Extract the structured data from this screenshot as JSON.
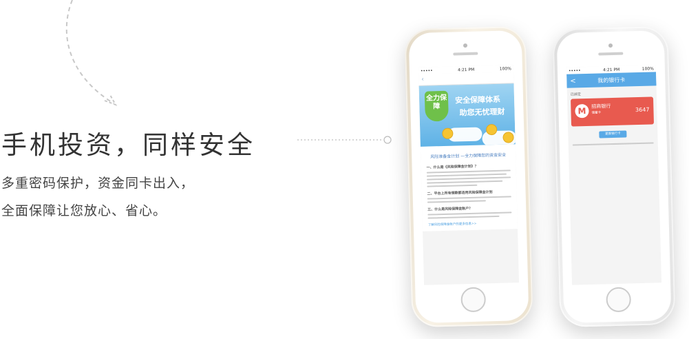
{
  "promo": {
    "heading": "手机投资，同样安全",
    "line1": "多重密码保护，资金同卡出入，",
    "line2": "全面保障让您放心、省心。"
  },
  "phone_left": {
    "status_time": "4:21 PM",
    "status_battery": "100%",
    "banner_badge": "全力保障",
    "banner_title": "安全保障体系",
    "banner_subtitle": "助您无忧理财",
    "article_title": "风险准备金计划 —全力保障您的资金安全",
    "section1": "一、什么是《风险保障金计划》？",
    "section2": "二、平台上所有借款都适用风险保障金计划",
    "section3": "三、什么是风险保障金账户？",
    "link_text": "了解风险保障金账户的更多信息>>"
  },
  "phone_right": {
    "status_time": "4:21 PM",
    "status_battery": "100%",
    "nav_title": "我的银行卡",
    "back_icon": "<",
    "bound_label": "已绑定",
    "bank_logo": "M",
    "bank_name": "招商银行",
    "card_type": "储蓄卡",
    "card_tail": "3647",
    "unbind_button": "更换银行卡"
  },
  "colors": {
    "accent_blue": "#59a9e6",
    "card_red": "#e85a4f",
    "shield_green": "#6fc04a"
  }
}
